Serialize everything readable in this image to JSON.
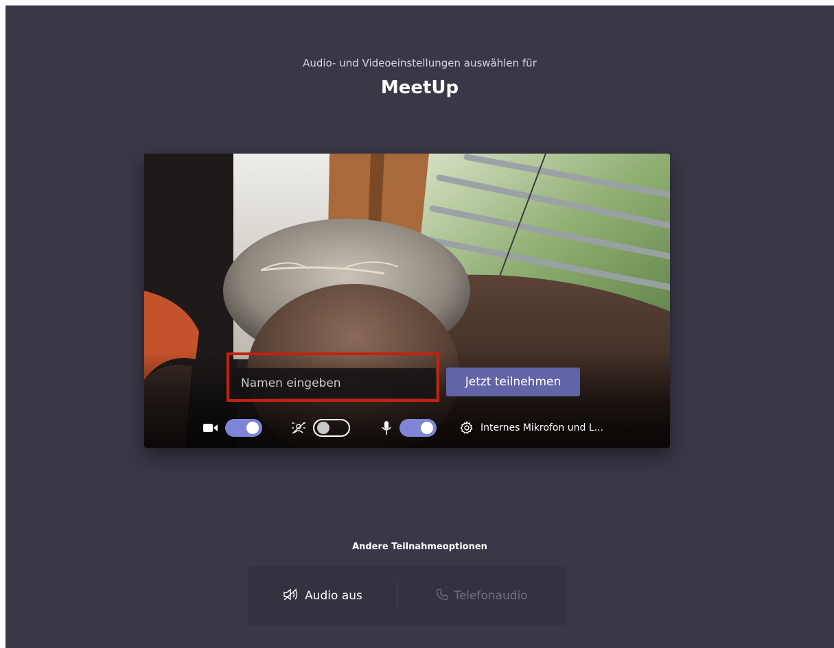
{
  "header": {
    "subtitle": "Audio- und Videoeinstellungen auswählen für",
    "meeting_title": "MeetUp"
  },
  "preview": {
    "name_input": {
      "placeholder": "Namen eingeben",
      "value": ""
    },
    "join_label": "Jetzt teilnehmen",
    "controls": {
      "camera": {
        "icon": "camera-icon",
        "enabled": true
      },
      "background_blur": {
        "icon": "blur-icon",
        "enabled": false
      },
      "microphone": {
        "icon": "microphone-icon",
        "enabled": true
      },
      "device_settings": {
        "icon": "gear-icon",
        "label": "Internes Mikrofon und L..."
      }
    }
  },
  "other_options": {
    "title": "Andere Teilnahmeoptionen",
    "audio_off": {
      "icon": "speaker-off-icon",
      "label": "Audio aus"
    },
    "phone_audio": {
      "icon": "phone-icon",
      "label": "Telefonaudio"
    }
  },
  "colors": {
    "background": "#393846",
    "accent": "#6264a7",
    "toggle_on": "#7f85d6",
    "highlight": "#c4210f"
  }
}
